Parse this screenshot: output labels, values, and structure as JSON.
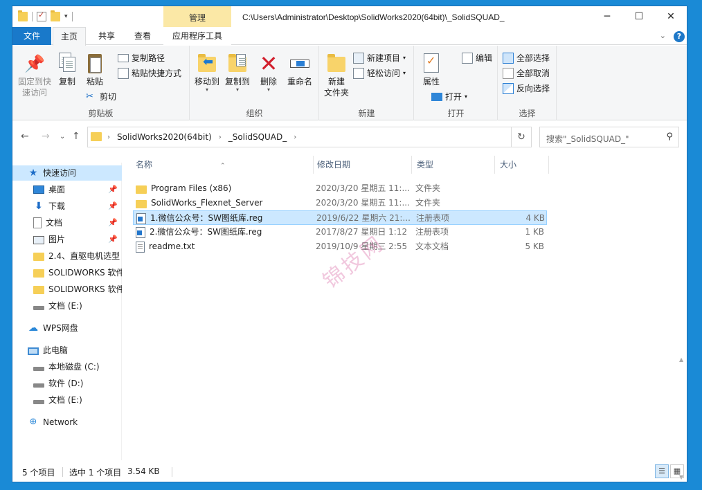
{
  "window": {
    "title_path": "C:\\Users\\Administrator\\Desktop\\SolidWorks2020(64bit)\\_SolidSQUAD_",
    "manage_tab": "管理",
    "min_glyph": "─",
    "max_glyph": "☐",
    "close_glyph": "✕"
  },
  "tabs": {
    "file": "文件",
    "home": "主页",
    "share": "共享",
    "view": "查看",
    "app_tools": "应用程序工具",
    "expand_glyph": "⌄",
    "help_glyph": "?"
  },
  "ribbon": {
    "clipboard": {
      "label": "剪贴板",
      "pin_line1": "固定到快",
      "pin_line2": "速访问",
      "copy": "复制",
      "paste": "粘贴",
      "copy_path": "复制路径",
      "paste_shortcut": "粘贴快捷方式",
      "cut": "剪切"
    },
    "organize": {
      "label": "组织",
      "move_to": "移动到",
      "copy_to": "复制到",
      "delete": "删除",
      "rename": "重命名"
    },
    "new": {
      "label": "新建",
      "new_folder_line1": "新建",
      "new_folder_line2": "文件夹",
      "new_item": "新建项目",
      "easy_access": "轻松访问"
    },
    "open": {
      "label": "打开",
      "properties": "属性",
      "open": "打开",
      "edit": "编辑"
    },
    "select": {
      "label": "选择",
      "select_all": "全部选择",
      "select_none": "全部取消",
      "invert": "反向选择"
    }
  },
  "address": {
    "crumbs": [
      "SolidWorks2020(64bit)",
      "_SolidSQUAD_"
    ],
    "search_placeholder": "搜索\"_SolidSQUAD_\""
  },
  "nav_pane": {
    "items": [
      {
        "label": "快速访问",
        "icon": "star-icon",
        "pinned": false,
        "selected": true
      },
      {
        "label": "桌面",
        "icon": "desktop-icon",
        "pinned": true
      },
      {
        "label": "下载",
        "icon": "download-icon",
        "pinned": true
      },
      {
        "label": "文档",
        "icon": "document-icon",
        "pinned": true
      },
      {
        "label": "图片",
        "icon": "picture-icon",
        "pinned": true
      },
      {
        "label": "2.4、直驱电机选型",
        "icon": "folder-icon",
        "pinned": false
      },
      {
        "label": "SOLIDWORKS 软件",
        "icon": "folder-icon",
        "pinned": false
      },
      {
        "label": "SOLIDWORKS 软件",
        "icon": "folder-icon",
        "pinned": false
      },
      {
        "label": "文档 (E:)",
        "icon": "drive-icon",
        "pinned": false
      },
      {
        "label": "WPS网盘",
        "icon": "cloud-icon",
        "pinned": false
      },
      {
        "label": "此电脑",
        "icon": "computer-icon",
        "pinned": false
      },
      {
        "label": "本地磁盘 (C:)",
        "icon": "drive-icon",
        "pinned": false
      },
      {
        "label": "软件 (D:)",
        "icon": "drive-icon",
        "pinned": false
      },
      {
        "label": "文档 (E:)",
        "icon": "drive-icon",
        "pinned": false
      },
      {
        "label": "Network",
        "icon": "network-icon",
        "pinned": false
      }
    ]
  },
  "columns": {
    "name": "名称",
    "date": "修改日期",
    "type": "类型",
    "size": "大小"
  },
  "files": [
    {
      "name": "Program Files (x86)",
      "date": "2020/3/20 星期五 11:...",
      "type": "文件夹",
      "size": "",
      "icon": "folder-icon"
    },
    {
      "name": "SolidWorks_Flexnet_Server",
      "date": "2020/3/20 星期五 11:...",
      "type": "文件夹",
      "size": "",
      "icon": "folder-icon"
    },
    {
      "name": "1.微信公众号：SW图纸库.reg",
      "date": "2019/6/22 星期六 21:...",
      "type": "注册表项",
      "size": "4 KB",
      "icon": "registry-file-icon",
      "selected": true
    },
    {
      "name": "2.微信公众号：SW图纸库.reg",
      "date": "2017/8/27 星期日 1:12",
      "type": "注册表项",
      "size": "1 KB",
      "icon": "registry-file-icon"
    },
    {
      "name": "readme.txt",
      "date": "2019/10/9 星期三 2:55",
      "type": "文本文档",
      "size": "5 KB",
      "icon": "text-file-icon"
    }
  ],
  "watermark": "锦技网",
  "status": {
    "count": "5 个项目",
    "selection": "选中 1 个项目",
    "size": "3.54 KB"
  },
  "colors": {
    "accent": "#1979ca",
    "selection": "#cce8ff",
    "manage_tab": "#fbe8a6",
    "desktop_bg": "#1a8ad6"
  }
}
